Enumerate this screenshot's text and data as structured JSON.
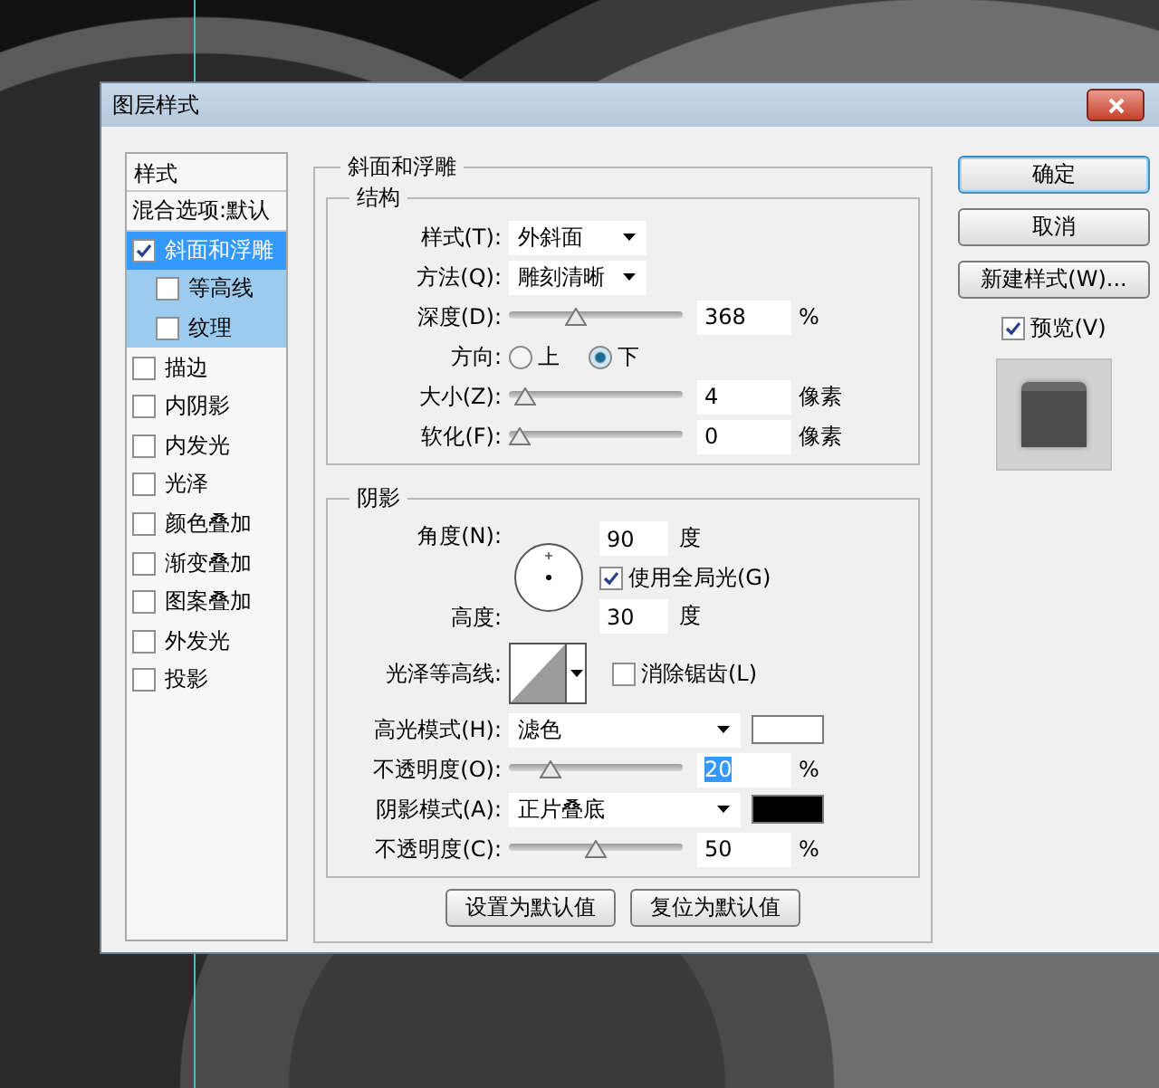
{
  "window": {
    "title": "图层样式"
  },
  "sidebar": {
    "header": "样式",
    "items": [
      {
        "label": "混合选项:默认",
        "kind": "heading",
        "selected": false
      },
      {
        "label": "斜面和浮雕",
        "kind": "check",
        "checked": true,
        "selected": true,
        "children": [
          {
            "label": "等高线",
            "kind": "check",
            "checked": false,
            "selected": false
          },
          {
            "label": "纹理",
            "kind": "check",
            "checked": false,
            "selected": false
          }
        ]
      },
      {
        "label": "描边",
        "kind": "check",
        "checked": false,
        "selected": false
      },
      {
        "label": "内阴影",
        "kind": "check",
        "checked": false,
        "selected": false
      },
      {
        "label": "内发光",
        "kind": "check",
        "checked": false,
        "selected": false
      },
      {
        "label": "光泽",
        "kind": "check",
        "checked": false,
        "selected": false
      },
      {
        "label": "颜色叠加",
        "kind": "check",
        "checked": false,
        "selected": false
      },
      {
        "label": "渐变叠加",
        "kind": "check",
        "checked": false,
        "selected": false
      },
      {
        "label": "图案叠加",
        "kind": "check",
        "checked": false,
        "selected": false
      },
      {
        "label": "外发光",
        "kind": "check",
        "checked": false,
        "selected": false
      },
      {
        "label": "投影",
        "kind": "check",
        "checked": false,
        "selected": false
      }
    ]
  },
  "panel": {
    "title": "斜面和浮雕",
    "structure": {
      "title": "结构",
      "rows": [
        {
          "kind": "dropdown",
          "label": "样式(T):",
          "value": "外斜面"
        },
        {
          "kind": "dropdown",
          "label": "方法(Q):",
          "value": "雕刻清晰"
        },
        {
          "kind": "slider",
          "label": "深度(D):",
          "level": 0.37,
          "value": "368",
          "unit": "%",
          "highlighted": false
        },
        {
          "kind": "radio",
          "label": "方向:",
          "options": [
            {
              "label": "上",
              "selected": false
            },
            {
              "label": "下",
              "selected": true
            }
          ]
        },
        {
          "kind": "slider",
          "label": "大小(Z):",
          "level": 0.03,
          "value": "4",
          "unit": "像素",
          "highlighted": false
        },
        {
          "kind": "slider",
          "label": "软化(F):",
          "level": 0,
          "value": "0",
          "unit": "像素",
          "highlighted": false
        }
      ]
    },
    "shading": {
      "title": "阴影",
      "angle": {
        "label": "角度(N):",
        "value": "90",
        "unit": "度"
      },
      "global_light": {
        "label": "使用全局光(G)",
        "checked": true
      },
      "altitude": {
        "label": "高度:",
        "value": "30",
        "unit": "度"
      },
      "gloss_contour": {
        "label": "光泽等高线:"
      },
      "anti_aliased": {
        "label": "消除锯齿(L)",
        "checked": false
      },
      "rows": [
        {
          "kind": "mode",
          "label": "高光模式(H):",
          "value": "滤色",
          "color": "#ffffff"
        },
        {
          "kind": "slider",
          "label": "不透明度(O):",
          "level": 0.2,
          "value": "20",
          "unit": "%",
          "highlighted": true
        },
        {
          "kind": "mode",
          "label": "阴影模式(A):",
          "value": "正片叠底",
          "color": "#000000"
        },
        {
          "kind": "slider",
          "label": "不透明度(C):",
          "level": 0.5,
          "value": "50",
          "unit": "%",
          "highlighted": false
        }
      ]
    },
    "footer_buttons": [
      "设置为默认值",
      "复位为默认值"
    ]
  },
  "actions": {
    "buttons": [
      {
        "label": "确定",
        "default": true
      },
      {
        "label": "取消",
        "default": false
      },
      {
        "label": "新建样式(W)...",
        "default": false
      }
    ],
    "preview": {
      "label": "预览(V)",
      "checked": true
    }
  }
}
